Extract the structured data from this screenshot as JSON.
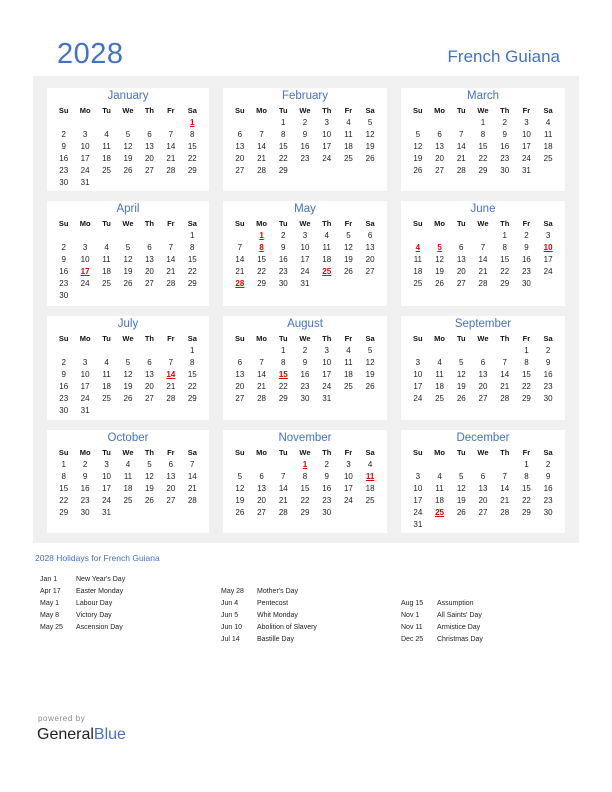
{
  "header": {
    "year": "2028",
    "country": "French Guiana"
  },
  "weekdays": [
    "Su",
    "Mo",
    "Tu",
    "We",
    "Th",
    "Fr",
    "Sa"
  ],
  "colors": {
    "accent": "#4472c4",
    "holiday": "#e00000",
    "panel": "#f0f0f0"
  },
  "months": [
    {
      "name": "January",
      "start": 6,
      "days": 31,
      "holidays": [
        1
      ]
    },
    {
      "name": "February",
      "start": 2,
      "days": 29,
      "holidays": []
    },
    {
      "name": "March",
      "start": 3,
      "days": 31,
      "holidays": []
    },
    {
      "name": "April",
      "start": 6,
      "days": 30,
      "holidays": [
        17
      ]
    },
    {
      "name": "May",
      "start": 1,
      "days": 31,
      "holidays": [
        1,
        8,
        25,
        28
      ]
    },
    {
      "name": "June",
      "start": 4,
      "days": 30,
      "holidays": [
        4,
        5,
        10
      ]
    },
    {
      "name": "July",
      "start": 6,
      "days": 31,
      "holidays": [
        14
      ]
    },
    {
      "name": "August",
      "start": 2,
      "days": 31,
      "holidays": [
        15
      ]
    },
    {
      "name": "September",
      "start": 5,
      "days": 30,
      "holidays": []
    },
    {
      "name": "October",
      "start": 0,
      "days": 31,
      "holidays": []
    },
    {
      "name": "November",
      "start": 3,
      "days": 30,
      "holidays": [
        1,
        11
      ]
    },
    {
      "name": "December",
      "start": 5,
      "days": 31,
      "holidays": [
        25
      ]
    }
  ],
  "holidays_title": "2028 Holidays for French Guiana",
  "holiday_columns": [
    [
      {
        "date": "Jan 1",
        "name": "New Year's Day"
      },
      {
        "date": "Apr 17",
        "name": "Easter Monday"
      },
      {
        "date": "May 1",
        "name": "Labour Day"
      },
      {
        "date": "May 8",
        "name": "Victory Day"
      },
      {
        "date": "May 25",
        "name": "Ascension Day"
      }
    ],
    [
      {
        "date": "May 28",
        "name": "Mother's Day"
      },
      {
        "date": "Jun 4",
        "name": "Pentecost"
      },
      {
        "date": "Jun 5",
        "name": "Whit Monday"
      },
      {
        "date": "Jun 10",
        "name": "Abolition of Slavery"
      },
      {
        "date": "Jul 14",
        "name": "Bastille Day"
      }
    ],
    [
      {
        "date": "Aug 15",
        "name": "Assumption"
      },
      {
        "date": "Nov 1",
        "name": "All Saints' Day"
      },
      {
        "date": "Nov 11",
        "name": "Armistice Day"
      },
      {
        "date": "Dec 25",
        "name": "Christmas Day"
      }
    ]
  ],
  "footer": {
    "powered_by": "powered by",
    "brand_general": "General",
    "brand_blue": "Blue"
  }
}
